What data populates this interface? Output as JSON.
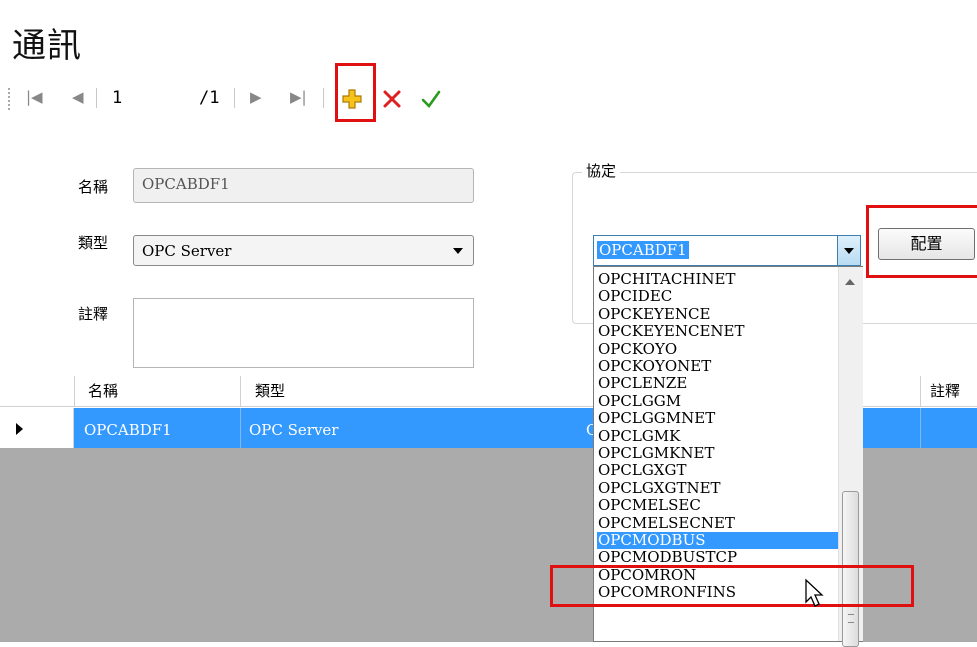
{
  "page_title": "通訊",
  "nav": {
    "first_icon": "first-page-icon",
    "prev_icon": "previous-page-icon",
    "page_value": "1",
    "page_total": "/1",
    "next_icon": "next-page-icon",
    "last_icon": "last-page-icon"
  },
  "toolbar": {
    "add_icon": "plus-icon",
    "delete_icon": "close-icon",
    "confirm_icon": "check-icon"
  },
  "form": {
    "name_label": "名稱",
    "name_value": "OPCABDF1",
    "type_label": "類型",
    "type_value": "OPC Server",
    "comment_label": "註釋",
    "comment_value": ""
  },
  "protocol": {
    "legend": "協定",
    "selected": "OPCABDF1",
    "config_button": "配置"
  },
  "dropdown_options": [
    "OPCHITACHINET",
    "OPCIDEC",
    "OPCKEYENCE",
    "OPCKEYENCENET",
    "OPCKOYO",
    "OPCKOYONET",
    "OPCLENZE",
    "OPCLGGM",
    "OPCLGGMNET",
    "OPCLGMK",
    "OPCLGMKNET",
    "OPCLGXGT",
    "OPCLGXGTNET",
    "OPCMELSEC",
    "OPCMELSECNET",
    "OPCMODBUS",
    "OPCMODBUSTCP",
    "OPCOMRON",
    "OPCOMRONFINS"
  ],
  "dropdown_highlighted": "OPCMODBUS",
  "grid": {
    "headers": {
      "name": "名稱",
      "type": "類型",
      "comment": "註釋"
    },
    "row": {
      "name": "OPCABDF1",
      "type": "OPC Server",
      "protocol_partial": "C"
    }
  },
  "colors": {
    "selection": "#3399ff",
    "highlight_box": "#e01010",
    "grey_area": "#ababab"
  }
}
